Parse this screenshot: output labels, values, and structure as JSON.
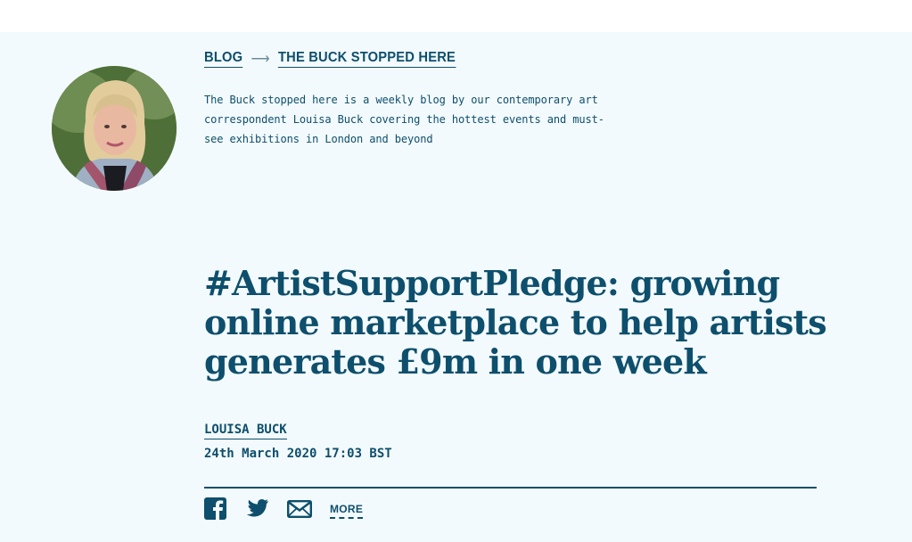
{
  "breadcrumb": {
    "items": [
      {
        "label": "BLOG"
      },
      {
        "label": "THE BUCK STOPPED HERE"
      }
    ],
    "separator": "⟶"
  },
  "column": {
    "description": "The Buck stopped here is a weekly blog by our contemporary art correspondent Louisa Buck covering the hottest events and must-see exhibitions in London and beyond"
  },
  "article": {
    "title": "#ArtistSupportPledge: growing online marketplace to help artists generates £9m in one week",
    "author": "LOUISA BUCK",
    "date": "24th March 2020 17:03 BST"
  },
  "share": {
    "icons": [
      "facebook-icon",
      "twitter-icon",
      "mail-icon"
    ],
    "more_label": "MORE"
  },
  "colors": {
    "accent": "#0d4f6c",
    "panel_background": "#f3fafd"
  }
}
